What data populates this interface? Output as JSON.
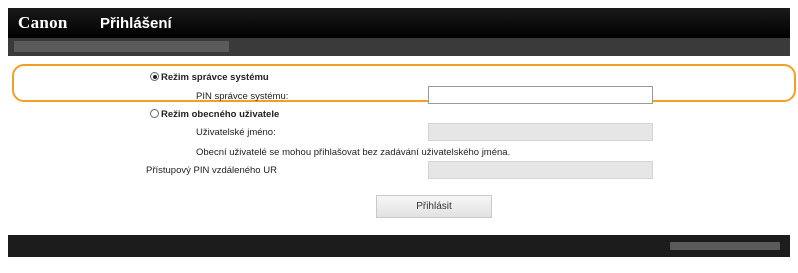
{
  "header": {
    "logo": "Canon",
    "title": "Přihlášení"
  },
  "form": {
    "admin_mode": {
      "label": "Režim správce systému",
      "selected": true,
      "pin_label": "PIN správce systému:",
      "pin_value": ""
    },
    "general_mode": {
      "label": "Režim obecného uživatele",
      "selected": false,
      "username_label": "Uživatelské jméno:",
      "username_value": "",
      "note": "Obecní uživatelé se mohou přihlašovat bez zadávání uživatelského jména."
    },
    "remote_ui_pin": {
      "label": "Přístupový PIN vzdáleného UR",
      "value": ""
    },
    "login_button": "Přihlásit"
  },
  "colors": {
    "header_bg": "#000000",
    "highlight_border": "#f0a023",
    "disabled_field": "#e6e6e6"
  }
}
